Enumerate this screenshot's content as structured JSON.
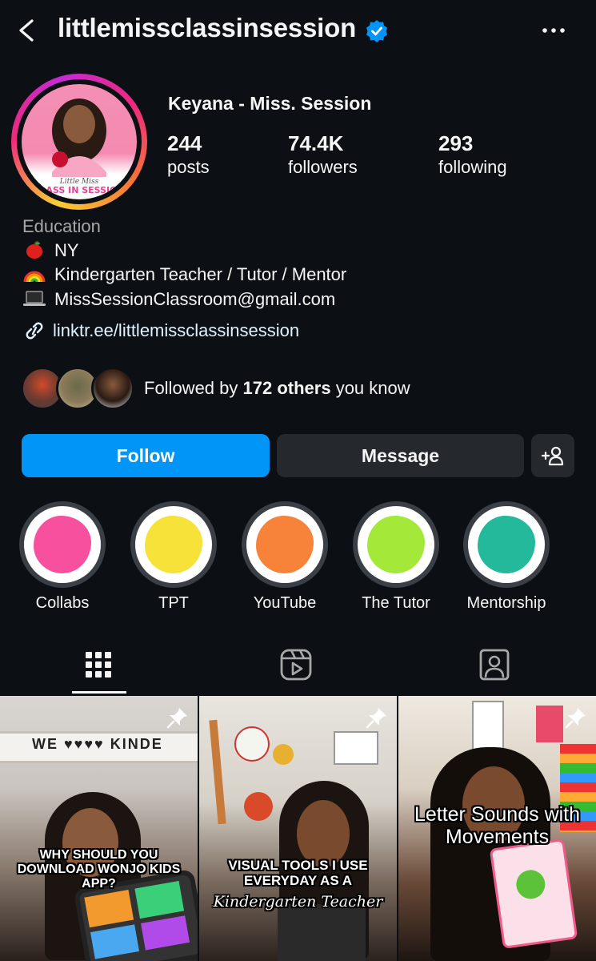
{
  "header": {
    "username": "littlemissclassinsession",
    "verified": true,
    "icons": [
      "back-arrow-icon",
      "verified-badge-icon",
      "more-options-icon"
    ]
  },
  "profile": {
    "display_name": "Keyana - Miss. Session",
    "avatar_text": "Little Miss CLASS IN SESSION",
    "stats": {
      "posts": {
        "value": "244",
        "label": "posts"
      },
      "followers": {
        "value": "74.4K",
        "label": "followers"
      },
      "following": {
        "value": "293",
        "label": "following"
      }
    },
    "category": "Education",
    "bio": [
      {
        "icon": "apple-emoji",
        "text": "NY"
      },
      {
        "icon": "rainbow-emoji",
        "text": "Kindergarten Teacher / Tutor / Mentor"
      },
      {
        "icon": "laptop-emoji",
        "text": "MissSessionClassroom@gmail.com"
      }
    ],
    "link": "linktr.ee/littlemissclassinsession",
    "mutual": {
      "prefix": "Followed by ",
      "count": "172 others",
      "suffix": " you know"
    }
  },
  "actions": {
    "follow": "Follow",
    "message": "Message",
    "suggest_icon": "add-person-icon"
  },
  "highlights": [
    {
      "label": "Collabs",
      "color": "#f7509f"
    },
    {
      "label": "TPT",
      "color": "#f7e23a"
    },
    {
      "label": "YouTube",
      "color": "#f7823a"
    },
    {
      "label": "The Tutor",
      "color": "#a4e83a"
    },
    {
      "label": "Mentorship",
      "color": "#23b99a"
    }
  ],
  "tabs": [
    "posts-grid-icon",
    "reels-icon",
    "tagged-icon"
  ],
  "posts": [
    {
      "caption": "WHY SHOULD YOU DOWNLOAD WONJO KIDS APP?",
      "pinned": true,
      "sign_text": "WE ♥♥♥♥ KINDE"
    },
    {
      "caption": "VISUAL TOOLS I USE EVERYDAY AS A",
      "caption_script": "Kindergarten Teacher",
      "pinned": true
    },
    {
      "caption": "Letter Sounds with Movements",
      "pinned": true
    }
  ],
  "colors": {
    "background": "#0c1014",
    "primary": "#0095f6",
    "secondary_button": "#25292e",
    "link": "#e0f1ff",
    "muted": "#a8a8a8"
  }
}
